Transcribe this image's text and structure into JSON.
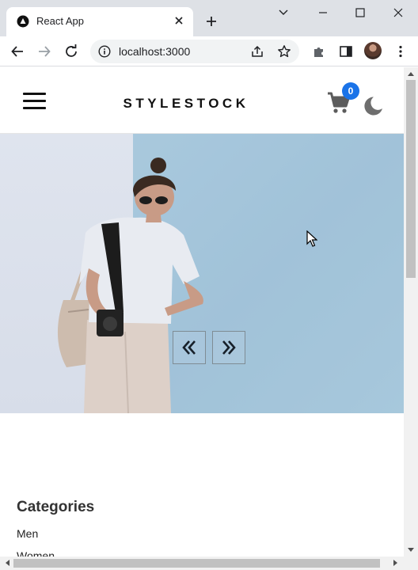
{
  "browser": {
    "tab_title": "React App",
    "url": "localhost:3000"
  },
  "app": {
    "brand": "STYLESTOCK",
    "cart_count": "0",
    "slider": {
      "prev_glyph": "«",
      "next_glyph": "»"
    },
    "categories": {
      "title": "Categories",
      "items": [
        "Men",
        "Women"
      ]
    }
  },
  "icons": {
    "tab_favicon": "react-favicon-icon",
    "tab_close": "close-icon",
    "new_tab": "plus-icon",
    "tab_search": "chevron-down-icon",
    "minimize": "minimize-icon",
    "maximize": "maximize-icon",
    "close_window": "close-icon",
    "back": "arrow-left-icon",
    "forward": "arrow-right-icon",
    "reload": "reload-icon",
    "site_info": "info-icon",
    "share": "share-icon",
    "bookmark": "star-icon",
    "extensions": "puzzle-icon",
    "side_panel": "side-panel-icon",
    "menu": "more-vertical-icon",
    "hamburger": "hamburger-menu-icon",
    "cart": "shopping-cart-icon",
    "theme": "moon-icon"
  },
  "colors": {
    "badge": "#1a73e8",
    "brand_text": "#111111",
    "hero_wall": "#a9c9de"
  }
}
